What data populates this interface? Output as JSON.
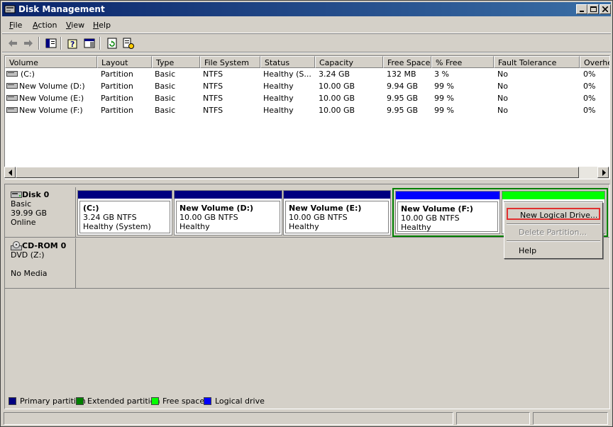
{
  "window": {
    "title": "Disk Management"
  },
  "menu": [
    {
      "label": "File",
      "accel": "F"
    },
    {
      "label": "Action",
      "accel": "A"
    },
    {
      "label": "View",
      "accel": "V"
    },
    {
      "label": "Help",
      "accel": "H"
    }
  ],
  "toolbar": {
    "buttons": [
      "back-arrow-icon",
      "forward-arrow-icon",
      "show-hide-tree-icon",
      "help-icon",
      "properties-icon",
      "refresh-icon",
      "export-list-icon"
    ]
  },
  "volume_list": {
    "columns": [
      "Volume",
      "Layout",
      "Type",
      "File System",
      "Status",
      "Capacity",
      "Free Space",
      "% Free",
      "Fault Tolerance",
      "Overhe"
    ],
    "rows": [
      [
        "(C:)",
        "Partition",
        "Basic",
        "NTFS",
        "Healthy (S...",
        "3.24 GB",
        "132 MB",
        "3 %",
        "No",
        "0%"
      ],
      [
        "New Volume (D:)",
        "Partition",
        "Basic",
        "NTFS",
        "Healthy",
        "10.00 GB",
        "9.94 GB",
        "99 %",
        "No",
        "0%"
      ],
      [
        "New Volume (E:)",
        "Partition",
        "Basic",
        "NTFS",
        "Healthy",
        "10.00 GB",
        "9.95 GB",
        "99 %",
        "No",
        "0%"
      ],
      [
        "New Volume (F:)",
        "Partition",
        "Basic",
        "NTFS",
        "Healthy",
        "10.00 GB",
        "9.95 GB",
        "99 %",
        "No",
        "0%"
      ]
    ]
  },
  "disks": [
    {
      "name": "Disk 0",
      "type": "Basic",
      "size": "39.99 GB",
      "status": "Online",
      "partitions": [
        {
          "name": "(C:)",
          "size": "3.24 GB NTFS",
          "status": "Healthy (System)",
          "kind": "primary"
        },
        {
          "name": "New Volume  (D:)",
          "size": "10.00 GB NTFS",
          "status": "Healthy",
          "kind": "primary"
        },
        {
          "name": "New Volume  (E:)",
          "size": "10.00 GB NTFS",
          "status": "Healthy",
          "kind": "primary"
        },
        {
          "name": "New Volume  (F:)",
          "size": "10.00 GB NTFS",
          "status": "Healthy",
          "kind": "logical"
        }
      ]
    },
    {
      "name": "CD-ROM 0",
      "type": "DVD (Z:)",
      "status": "No Media"
    }
  ],
  "context_menu": {
    "items": [
      {
        "label": "New Logical Drive...",
        "enabled": true,
        "highlighted": true
      },
      {
        "label": "Delete Partition...",
        "enabled": false
      },
      {
        "label": "Help",
        "enabled": true
      }
    ]
  },
  "legend": [
    {
      "label": "Primary partition",
      "color": "#000080"
    },
    {
      "label": "Extended partition",
      "color": "#008000"
    },
    {
      "label": "Free space",
      "color": "#00ff00"
    },
    {
      "label": "Logical drive",
      "color": "#0000ff"
    }
  ]
}
